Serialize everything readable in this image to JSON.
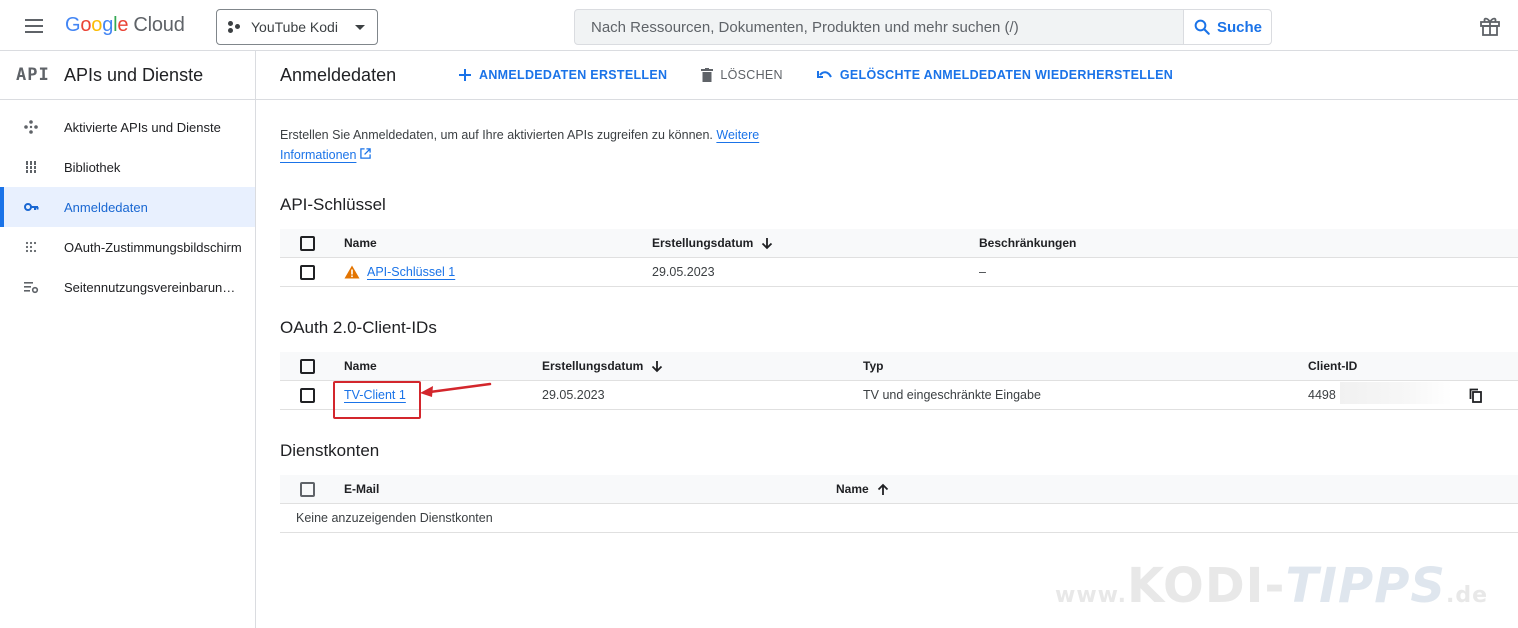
{
  "topbar": {
    "logo_letters": [
      "G",
      "o",
      "o",
      "g",
      "l",
      "e"
    ],
    "logo_suffix": "Cloud",
    "project_name": "YouTube Kodi",
    "search_placeholder": "Nach Ressourcen, Dokumenten, Produkten und mehr suchen (/)",
    "search_button": "Suche"
  },
  "sidebar": {
    "logo_text": "API",
    "title": "APIs und Dienste",
    "items": [
      {
        "label": "Aktivierte APIs und Dienste",
        "icon": "services-icon",
        "active": false
      },
      {
        "label": "Bibliothek",
        "icon": "library-icon",
        "active": false
      },
      {
        "label": "Anmeldedaten",
        "icon": "key-icon",
        "active": true
      },
      {
        "label": "OAuth-Zustimmungsbildschirm",
        "icon": "consent-icon",
        "active": false
      },
      {
        "label": "Seitennutzungsvereinbarungen",
        "icon": "settings-list-icon",
        "active": false
      }
    ]
  },
  "header": {
    "title": "Anmeldedaten",
    "create_label": "ANMELDEDATEN ERSTELLEN",
    "delete_label": "LÖSCHEN",
    "restore_label": "GELÖSCHTE ANMELDEDATEN WIEDERHERSTELLEN"
  },
  "intro": {
    "text": "Erstellen Sie Anmeldedaten, um auf Ihre aktivierten APIs zugreifen zu können.",
    "link_1": "Weitere",
    "link_2": "Informationen"
  },
  "api_keys": {
    "title": "API-Schlüssel",
    "columns": [
      "Name",
      "Erstellungsdatum",
      "Beschränkungen"
    ],
    "rows": [
      {
        "name": "API-Schlüssel 1",
        "date": "29.05.2023",
        "restrictions": "–"
      }
    ]
  },
  "oauth": {
    "title": "OAuth 2.0-Client-IDs",
    "columns": [
      "Name",
      "Erstellungsdatum",
      "Typ",
      "Client-ID"
    ],
    "rows": [
      {
        "name": "TV-Client 1",
        "date": "29.05.2023",
        "type": "TV und eingeschränkte Eingabe",
        "client_id": "4498"
      }
    ]
  },
  "service_accounts": {
    "title": "Dienstkonten",
    "columns": [
      "E-Mail",
      "Name"
    ],
    "empty_text": "Keine anzuzeigenden Dienstkonten"
  },
  "watermark": {
    "prefix": "www.",
    "main": "KODI-",
    "accent": "TIPPS",
    "suffix": ".de"
  },
  "colors": {
    "accent": "#1a73e8",
    "active_bg": "#e8f0fe",
    "warning": "#e37400",
    "highlight": "#d3262c"
  }
}
